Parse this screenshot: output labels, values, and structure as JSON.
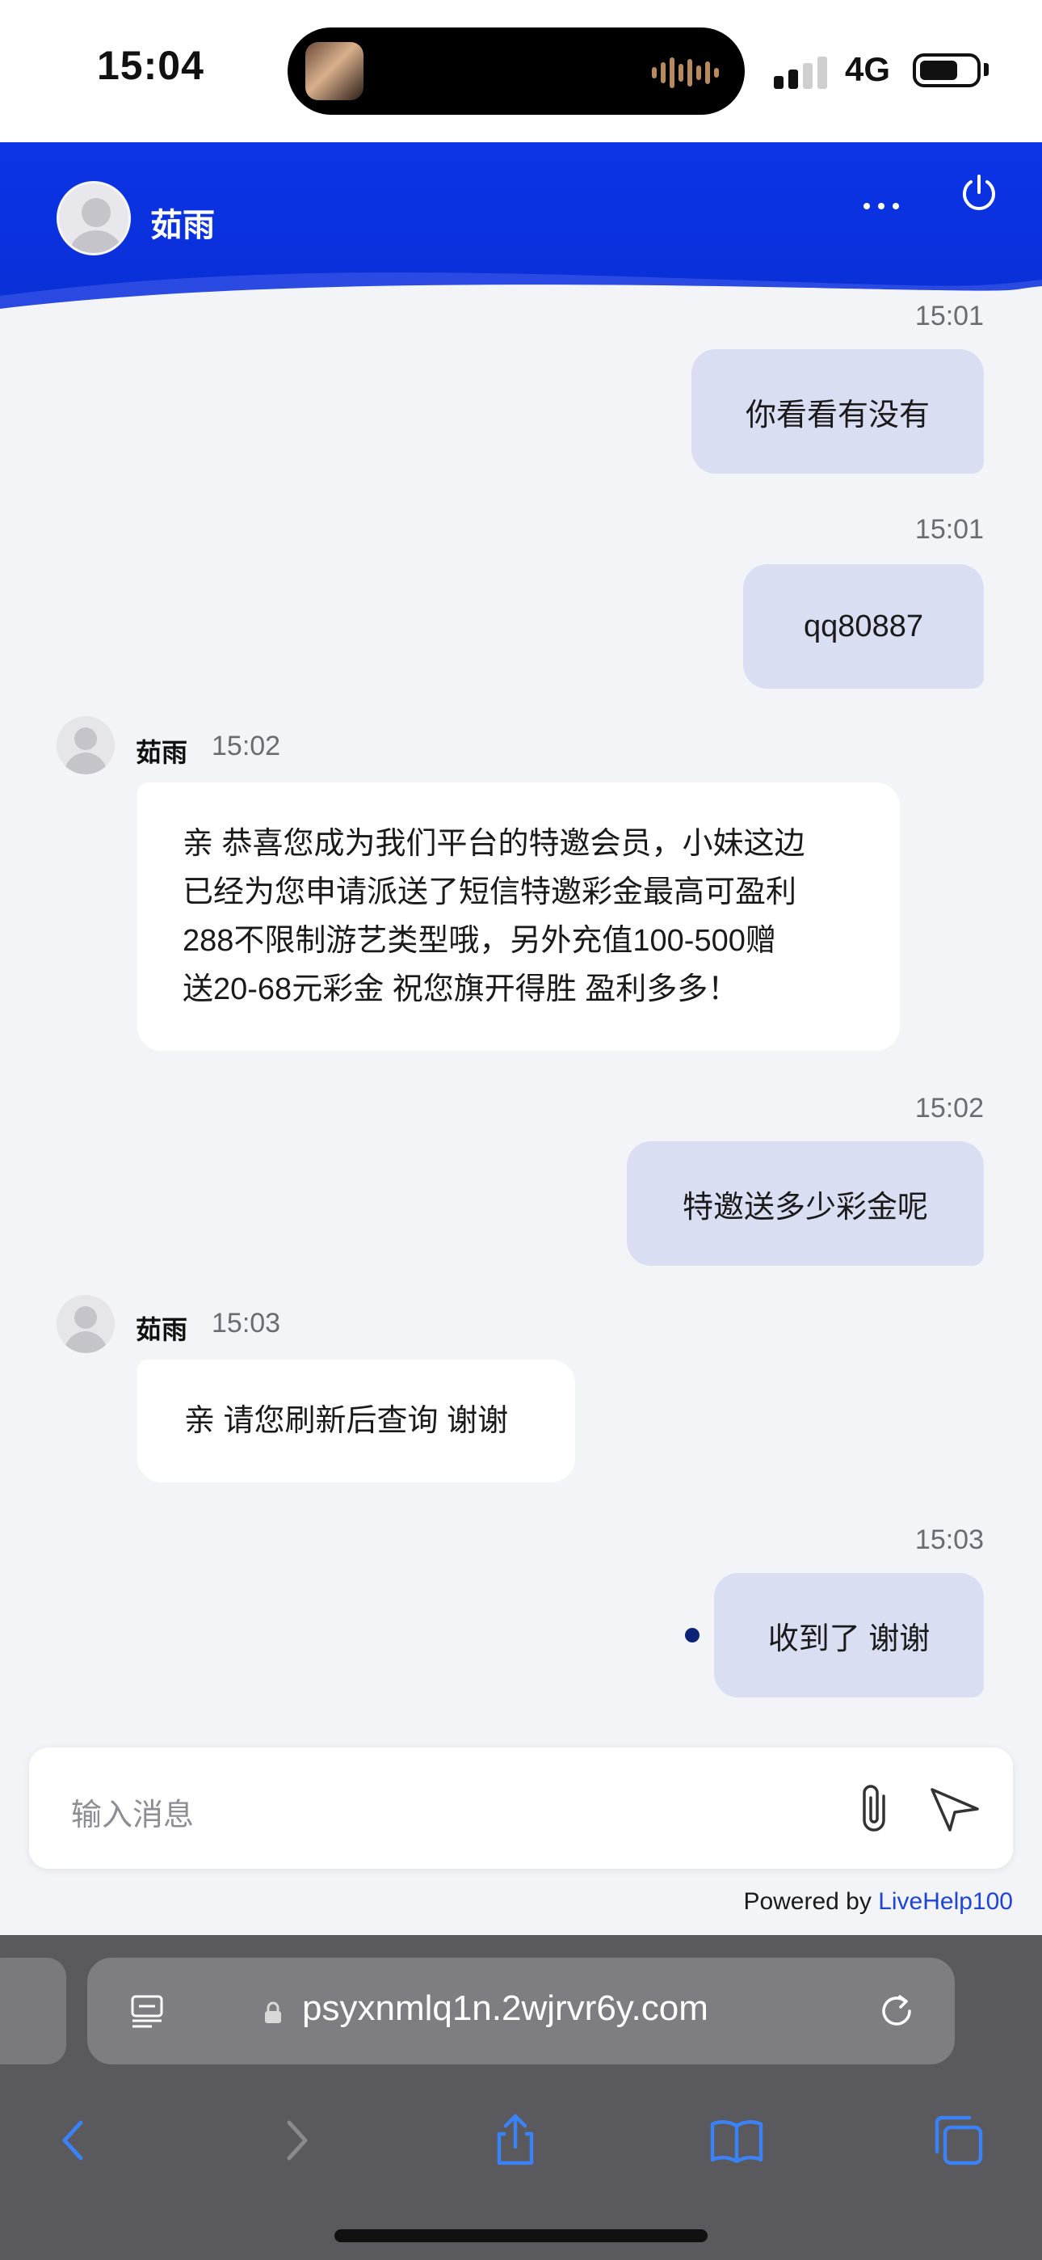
{
  "status_bar": {
    "time": "15:04",
    "network": "4G",
    "battery_icon": "battery-icon",
    "signal_icon": "cellular-signal-icon"
  },
  "header": {
    "agent_name": "茹雨",
    "more_icon": "more-dots-icon",
    "power_icon": "power-icon",
    "accent": "#0b34e6"
  },
  "messages": [
    {
      "side": "out",
      "time": "15:01",
      "text": "你看看有没有"
    },
    {
      "side": "out",
      "time": "15:01",
      "text": "qq80887"
    },
    {
      "side": "in",
      "name": "茹雨",
      "time": "15:02",
      "lines": [
        "亲 恭喜您成为我们平台的特邀会员，小妹这边",
        "已经为您申请派送了短信特邀彩金最高可盈利",
        "288不限制游艺类型哦，另外充值100-500赠",
        "送20-68元彩金 祝您旗开得胜 盈利多多！"
      ]
    },
    {
      "side": "out",
      "time": "15:02",
      "text": "特邀送多少彩金呢"
    },
    {
      "side": "in",
      "name": "茹雨",
      "time": "15:03",
      "lines": [
        "亲 请您刷新后查询 谢谢"
      ]
    },
    {
      "side": "out",
      "time": "15:03",
      "text": "收到了 谢谢"
    }
  ],
  "input": {
    "placeholder": "输入消息",
    "attach_icon": "paperclip-icon",
    "send_icon": "send-icon"
  },
  "footer": {
    "powered_prefix": "Powered by ",
    "powered_brand": "LiveHelp100",
    "brand_color": "#1f45d6"
  },
  "browser": {
    "url": "psyxnmlq1n.2wjrvr6y.com",
    "icons": [
      "reader-icon",
      "lock-icon",
      "reload-icon",
      "back-icon",
      "forward-icon",
      "share-icon",
      "bookmarks-icon",
      "tabs-icon"
    ]
  }
}
